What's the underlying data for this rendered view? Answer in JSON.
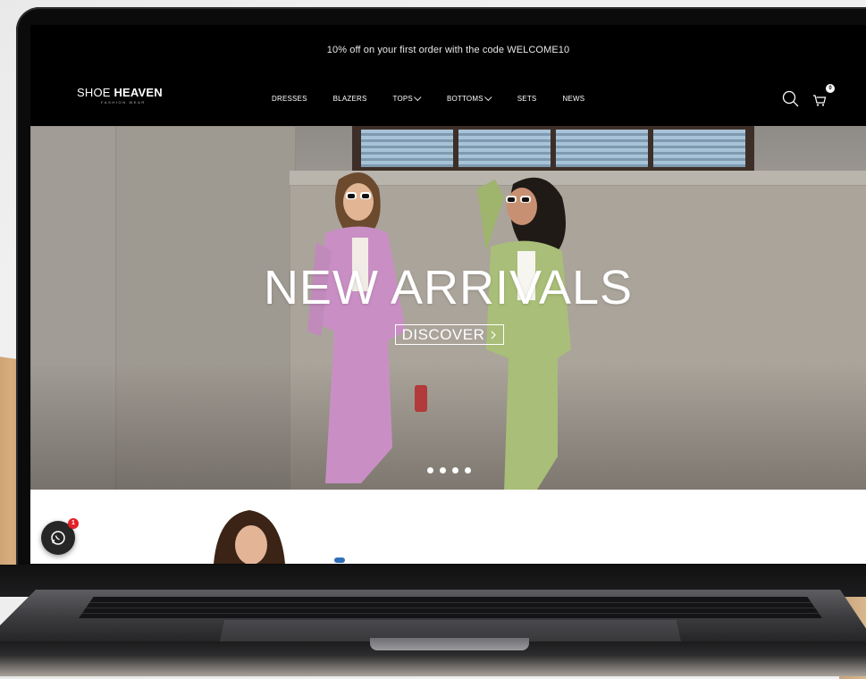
{
  "announcement": "10% off on your first order with the code WELCOME10",
  "brand": {
    "name_light": "SHOE ",
    "name_bold": "HEAVEN",
    "tagline": "FASHION WEAR"
  },
  "nav": [
    {
      "label": "DRESSES",
      "dropdown": false
    },
    {
      "label": "BLAZERS",
      "dropdown": false
    },
    {
      "label": "TOPS",
      "dropdown": true
    },
    {
      "label": "BOTTOMS",
      "dropdown": true
    },
    {
      "label": "SETS",
      "dropdown": false
    },
    {
      "label": "NEWS",
      "dropdown": false
    }
  ],
  "header_icons": {
    "search": "search-icon",
    "cart": "cart-icon",
    "cart_count": "0"
  },
  "hero": {
    "title": "NEW ARRIVALS",
    "cta": "DISCOVER",
    "cta_icon": "chevron-right-icon",
    "slides_count": 4,
    "active_slide": 1
  },
  "chat_widget": {
    "icon": "whatsapp-icon",
    "badge": "1"
  },
  "colors": {
    "header_bg": "#000000",
    "text_light": "#ffffff",
    "badge_red": "#e2202a",
    "pink_suit": "#c98fc4",
    "green_suit": "#a9be78"
  }
}
